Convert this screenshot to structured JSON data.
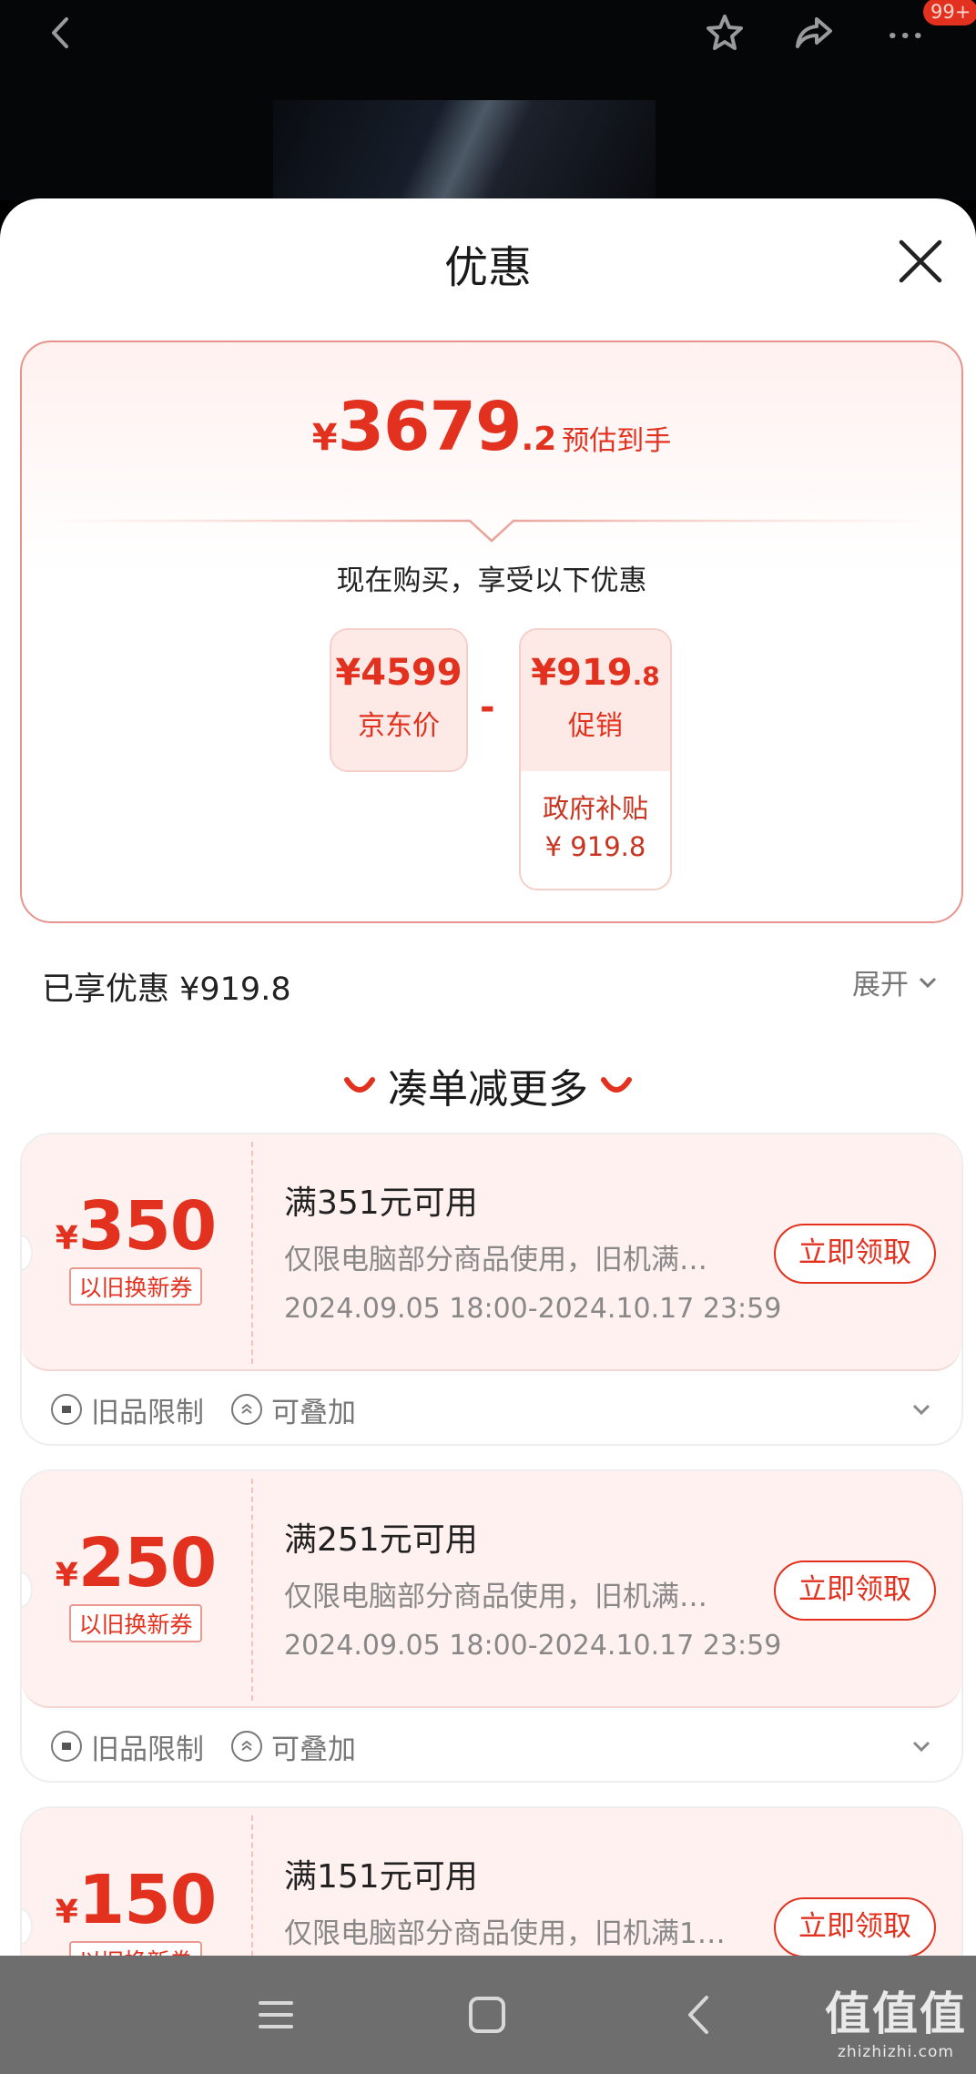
{
  "topbar": {
    "badge": "99+",
    "icons": [
      "back-icon",
      "star-icon",
      "share-icon",
      "more-icon"
    ]
  },
  "sheet": {
    "title": "优惠"
  },
  "estimate": {
    "currency": "¥",
    "integer": "3679",
    "decimal": ".2",
    "label": "预估到手"
  },
  "breakdown": {
    "caption": "现在购买，享受以下优惠",
    "base": {
      "amount": "¥4599",
      "label": "京东价"
    },
    "operator": "-",
    "discount": {
      "amount": "¥919",
      "amount_decimal": ".8",
      "label": "促销",
      "sub_label": "政府补贴",
      "sub_amount": "¥ 919.8"
    }
  },
  "enjoyed": {
    "text": "已享优惠 ¥919.8",
    "expand_label": "展开"
  },
  "more_section": {
    "title": "凑单减更多"
  },
  "coupons": [
    {
      "currency": "¥",
      "amount": "350",
      "tag": "以旧换新券",
      "condition": "满351元可用",
      "desc": "仅限电脑部分商品使用，旧机满…",
      "time": "2024.09.05 18:00-2024.10.17 23:59",
      "button": "立即领取",
      "tag1": "旧品限制",
      "tag2": "可叠加"
    },
    {
      "currency": "¥",
      "amount": "250",
      "tag": "以旧换新券",
      "condition": "满251元可用",
      "desc": "仅限电脑部分商品使用，旧机满…",
      "time": "2024.09.05 18:00-2024.10.17 23:59",
      "button": "立即领取",
      "tag1": "旧品限制",
      "tag2": "可叠加"
    },
    {
      "currency": "¥",
      "amount": "150",
      "tag": "以旧换新券",
      "condition": "满151元可用",
      "desc": "仅限电脑部分商品使用，旧机满1…",
      "time": "",
      "button": "立即领取",
      "tag1": "",
      "tag2": ""
    }
  ],
  "navbar": {
    "watermark": "值值值",
    "watermark_sub": "zhizhizhi.com"
  },
  "colors": {
    "accent": "#e2321f",
    "coupon_bg": "#fff1ef",
    "navbar": "#6e6e6e"
  }
}
